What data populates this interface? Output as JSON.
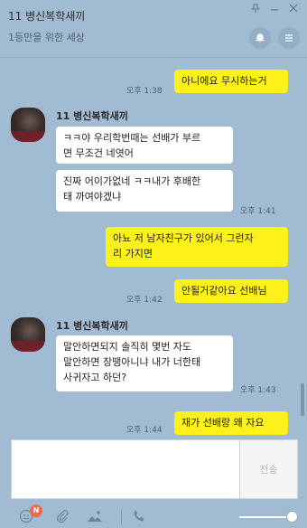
{
  "window": {
    "title": "11 병신복학새끼",
    "subtitle": "1등만을 위한 세상"
  },
  "messages": [
    {
      "dir": "out",
      "text": "아니에요 무시하는거",
      "time": "오후 1:38"
    },
    {
      "dir": "in",
      "sender": "11 병신복학새끼"
    },
    {
      "dir": "in",
      "text": "ㅋㅋ야 우리학번때는 선배가 부르\n면 무조건 네엿어"
    },
    {
      "dir": "in",
      "text": "진짜 어이가없네 ㅋㅋ내가 후배한\n태 까여야겠냐",
      "time": "오후 1:41"
    },
    {
      "dir": "out",
      "text": "아뇨 저 남자친구가 있어서 그런자\n리 가지면"
    },
    {
      "dir": "out",
      "text": "안될거같아요 선배님",
      "time": "오후 1:42"
    },
    {
      "dir": "in",
      "sender": "11 병신복학새끼"
    },
    {
      "dir": "in",
      "text": "말안하면되지 솔직히 몇번 자도\n말안하면 장땡아니냐 내가 너한태\n사귀자고 하던?",
      "time": "오후 1:43"
    },
    {
      "dir": "out",
      "text": "재가 선배랑 왜 자요",
      "time": "오후 1:44"
    }
  ],
  "input": {
    "send_label": "전송",
    "emoji_badge": "N"
  },
  "colors": {
    "background": "#a1bbd2",
    "outgoing_bubble": "#fef01b",
    "incoming_bubble": "#ffffff",
    "badge": "#ef6a4a"
  }
}
